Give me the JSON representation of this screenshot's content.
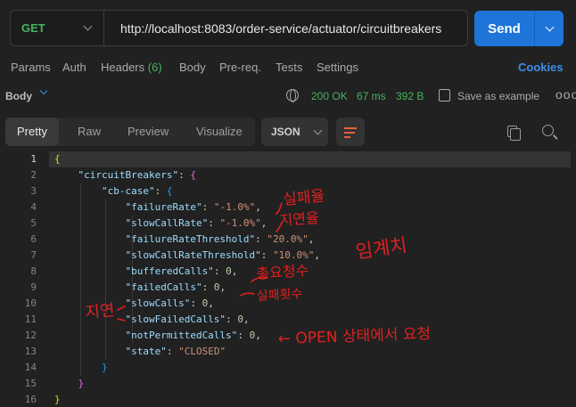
{
  "request": {
    "method": "GET",
    "url": "http://localhost:8083/order-service/actuator/circuitbreakers",
    "send_label": "Send"
  },
  "tabs": {
    "params": "Params",
    "auth": "Auth",
    "headers": "Headers",
    "headers_count": "(6)",
    "body": "Body",
    "prereq": "Pre-req.",
    "tests": "Tests",
    "settings": "Settings",
    "cookies": "Cookies"
  },
  "response": {
    "body_label": "Body",
    "status": "200 OK",
    "time": "67 ms",
    "size": "392 B",
    "save_label": "Save as example",
    "more": "ooo"
  },
  "view": {
    "tabs": [
      "Pretty",
      "Raw",
      "Preview",
      "Visualize"
    ],
    "active": "Pretty",
    "format": "JSON"
  },
  "code_lines": [
    {
      "n": "1",
      "parts": [
        [
          "brace1",
          "{"
        ]
      ]
    },
    {
      "n": "2",
      "parts": [
        [
          "key",
          "    \"circuitBreakers\""
        ],
        [
          "pun",
          ": "
        ],
        [
          "brace2",
          "{"
        ]
      ]
    },
    {
      "n": "3",
      "parts": [
        [
          "key",
          "        \"cb-case\""
        ],
        [
          "pun",
          ": "
        ],
        [
          "brace3",
          "{"
        ]
      ]
    },
    {
      "n": "4",
      "parts": [
        [
          "key",
          "            \"failureRate\""
        ],
        [
          "pun",
          ": "
        ],
        [
          "str",
          "\"-1.0%\""
        ],
        [
          "pun",
          ","
        ]
      ]
    },
    {
      "n": "5",
      "parts": [
        [
          "key",
          "            \"slowCallRate\""
        ],
        [
          "pun",
          ": "
        ],
        [
          "str",
          "\"-1.0%\""
        ],
        [
          "pun",
          ","
        ]
      ]
    },
    {
      "n": "6",
      "parts": [
        [
          "key",
          "            \"failureRateThreshold\""
        ],
        [
          "pun",
          ": "
        ],
        [
          "str",
          "\"20.0%\""
        ],
        [
          "pun",
          ","
        ]
      ]
    },
    {
      "n": "7",
      "parts": [
        [
          "key",
          "            \"slowCallRateThreshold\""
        ],
        [
          "pun",
          ": "
        ],
        [
          "str",
          "\"10.0%\""
        ],
        [
          "pun",
          ","
        ]
      ]
    },
    {
      "n": "8",
      "parts": [
        [
          "key",
          "            \"bufferedCalls\""
        ],
        [
          "pun",
          ": "
        ],
        [
          "num",
          "0"
        ],
        [
          "pun",
          ","
        ]
      ]
    },
    {
      "n": "9",
      "parts": [
        [
          "key",
          "            \"failedCalls\""
        ],
        [
          "pun",
          ": "
        ],
        [
          "num",
          "0"
        ],
        [
          "pun",
          ","
        ]
      ]
    },
    {
      "n": "10",
      "parts": [
        [
          "key",
          "            \"slowCalls\""
        ],
        [
          "pun",
          ": "
        ],
        [
          "num",
          "0"
        ],
        [
          "pun",
          ","
        ]
      ]
    },
    {
      "n": "11",
      "parts": [
        [
          "key",
          "            \"slowFailedCalls\""
        ],
        [
          "pun",
          ": "
        ],
        [
          "num",
          "0"
        ],
        [
          "pun",
          ","
        ]
      ]
    },
    {
      "n": "12",
      "parts": [
        [
          "key",
          "            \"notPermittedCalls\""
        ],
        [
          "pun",
          ": "
        ],
        [
          "num",
          "0"
        ],
        [
          "pun",
          ","
        ]
      ]
    },
    {
      "n": "13",
      "parts": [
        [
          "key",
          "            \"state\""
        ],
        [
          "pun",
          ": "
        ],
        [
          "str",
          "\"CLOSED\""
        ]
      ]
    },
    {
      "n": "14",
      "parts": [
        [
          "brace3",
          "        }"
        ]
      ]
    },
    {
      "n": "15",
      "parts": [
        [
          "brace2",
          "    }"
        ]
      ]
    },
    {
      "n": "16",
      "parts": [
        [
          "brace1",
          "}"
        ]
      ]
    }
  ],
  "annotations": {
    "failure_rate": "실패율",
    "slow_rate": "지연율",
    "threshold": "임계치",
    "total_requests": "총요청수",
    "failed_count": "실패횟수",
    "slow": "지연",
    "open_state": "← OPEN 상태에서 요청"
  },
  "colors": {
    "send": "#1e74d9",
    "ok": "#47b35f",
    "cookies": "#3b8fe6",
    "annotation": "#e02020"
  }
}
